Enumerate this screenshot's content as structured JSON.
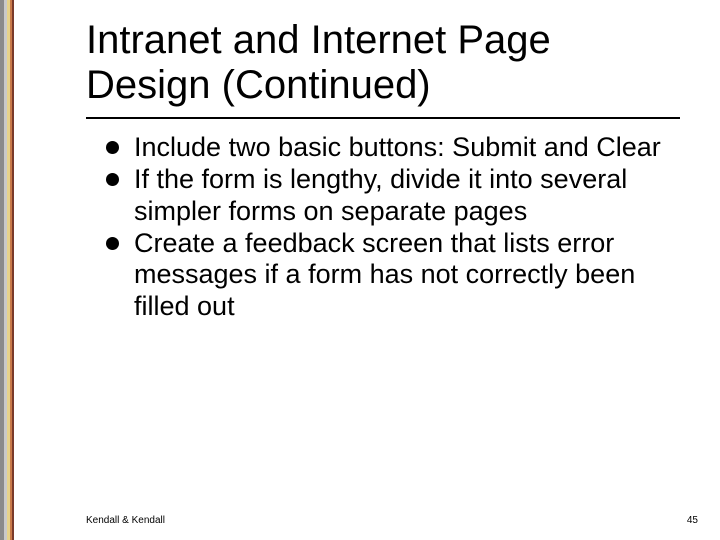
{
  "slide": {
    "title": "Intranet and Internet Page Design (Continued)",
    "bullets": [
      "Include two basic buttons: Submit and Clear",
      "If the form is lengthy, divide it into several simpler forms on separate pages",
      "Create a feedback screen that lists error messages if a form has not correctly been filled out"
    ],
    "footer_left": "Kendall & Kendall",
    "footer_right": "45"
  }
}
